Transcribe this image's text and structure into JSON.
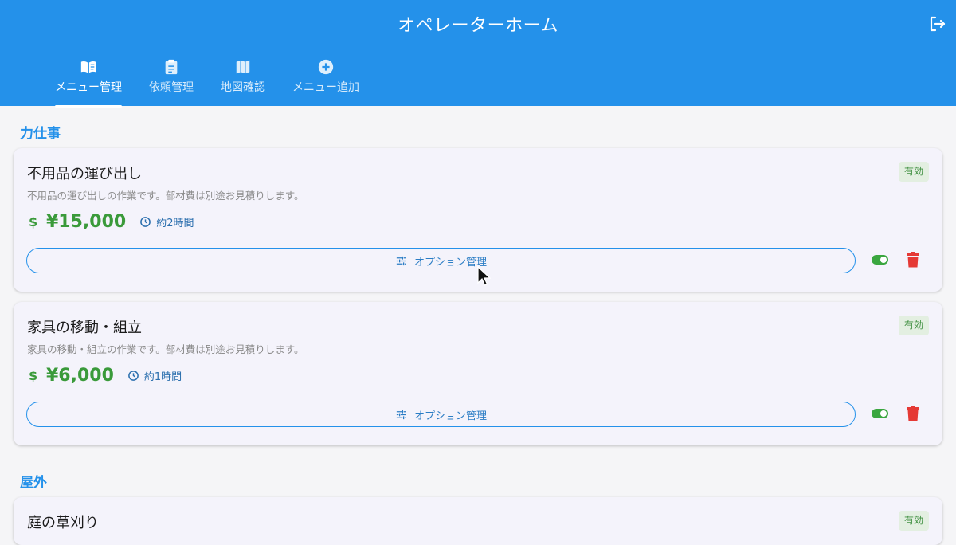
{
  "header": {
    "title": "オペレーターホーム",
    "logout_icon": "logout-icon",
    "tabs": [
      {
        "label": "メニュー管理",
        "icon": "menu-book-icon",
        "active": true
      },
      {
        "label": "依頼管理",
        "icon": "clipboard-icon",
        "active": false
      },
      {
        "label": "地図確認",
        "icon": "map-icon",
        "active": false
      },
      {
        "label": "メニュー追加",
        "icon": "add-circle-icon",
        "active": false
      }
    ]
  },
  "sections": [
    {
      "title": "力仕事",
      "items": [
        {
          "name": "不用品の運び出し",
          "description": "不用品の運び出しの作業です。部材費は別途お見積りします。",
          "status": "有効",
          "price": "¥15,000",
          "duration": "約2時間",
          "option_label": "オプション管理",
          "enabled": true
        },
        {
          "name": "家具の移動・組立",
          "description": "家具の移動・組立の作業です。部材費は別途お見積りします。",
          "status": "有効",
          "price": "¥6,000",
          "duration": "約1時間",
          "option_label": "オプション管理",
          "enabled": true
        }
      ]
    },
    {
      "title": "屋外",
      "items": [
        {
          "name": "庭の草刈り",
          "status": "有効"
        }
      ]
    }
  ],
  "colors": {
    "primary": "#2491ea",
    "price_green": "#3a9a3a",
    "delete_red": "#e53935",
    "badge_bg": "#e3efe1"
  }
}
